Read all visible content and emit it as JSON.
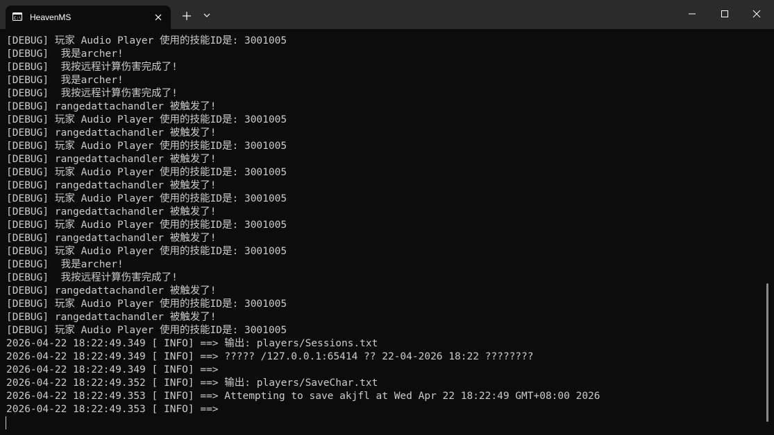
{
  "window": {
    "tab_title": "HeavenMS",
    "new_tab_symbol": "+"
  },
  "icons": {
    "tab": "terminal-icon",
    "tab_close": "close-icon",
    "new_tab": "plus-icon",
    "dropdown": "chevron-down-icon",
    "minimize": "minimize-icon",
    "maximize": "maximize-icon",
    "close": "close-icon"
  },
  "colors": {
    "titlebar": "#2b2b2b",
    "background": "#0c0c0c",
    "text": "#cccccc"
  },
  "terminal": {
    "lines": [
      "[DEBUG] 玩家 Audio Player 使用的技能ID是: 3001005",
      "[DEBUG]  我是archer!",
      "[DEBUG]  我按远程计算伤害完成了!",
      "[DEBUG]  我是archer!",
      "[DEBUG]  我按远程计算伤害完成了!",
      "[DEBUG] rangedattachandler 被触发了!",
      "[DEBUG] 玩家 Audio Player 使用的技能ID是: 3001005",
      "[DEBUG] rangedattachandler 被触发了!",
      "[DEBUG] 玩家 Audio Player 使用的技能ID是: 3001005",
      "[DEBUG] rangedattachandler 被触发了!",
      "[DEBUG] 玩家 Audio Player 使用的技能ID是: 3001005",
      "[DEBUG] rangedattachandler 被触发了!",
      "[DEBUG] 玩家 Audio Player 使用的技能ID是: 3001005",
      "[DEBUG] rangedattachandler 被触发了!",
      "[DEBUG] 玩家 Audio Player 使用的技能ID是: 3001005",
      "[DEBUG] rangedattachandler 被触发了!",
      "[DEBUG] 玩家 Audio Player 使用的技能ID是: 3001005",
      "[DEBUG]  我是archer!",
      "[DEBUG]  我按远程计算伤害完成了!",
      "[DEBUG] rangedattachandler 被触发了!",
      "[DEBUG] 玩家 Audio Player 使用的技能ID是: 3001005",
      "[DEBUG] rangedattachandler 被触发了!",
      "[DEBUG] 玩家 Audio Player 使用的技能ID是: 3001005",
      "2026-04-22 18:22:49.349 [ INFO] ==> 输出: players/Sessions.txt",
      "2026-04-22 18:22:49.349 [ INFO] ==> ????? /127.0.0.1:65414 ?? 22-04-2026 18:22 ????????",
      "2026-04-22 18:22:49.349 [ INFO] ==>",
      "2026-04-22 18:22:49.352 [ INFO] ==> 输出: players/SaveChar.txt",
      "2026-04-22 18:22:49.353 [ INFO] ==> Attempting to save akjfl at Wed Apr 22 18:22:49 GMT+08:00 2026",
      "2026-04-22 18:22:49.353 [ INFO] ==>"
    ]
  }
}
